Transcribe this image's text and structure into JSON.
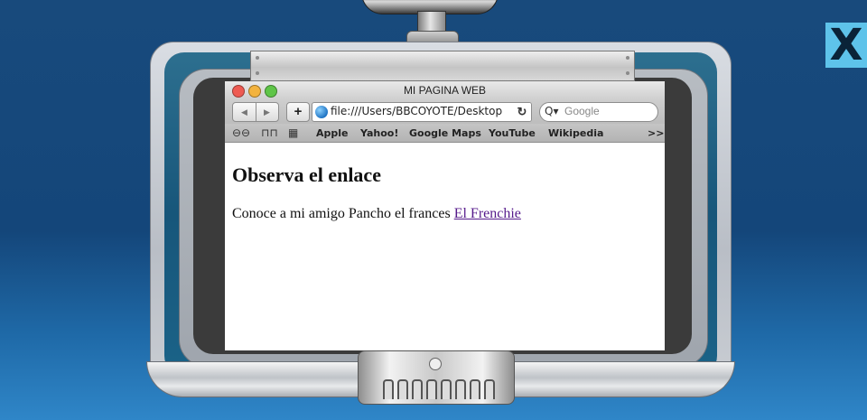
{
  "close_button": {
    "label": "X"
  },
  "browser": {
    "title": "MI PAGINA WEB",
    "url": "file:///Users/BBCOYOTE/Desktop",
    "search_placeholder": "Google",
    "bookmarks": [
      "Apple",
      "Yahoo!",
      "Google Maps",
      "YouTube",
      "Wikipedia"
    ],
    "bookmark_overflow": ">>"
  },
  "page": {
    "heading": "Observa el enlace",
    "text": "Conoce a mi amigo Pancho el frances ",
    "link_text": "El Frenchie"
  },
  "colors": {
    "background": "#184a7c",
    "close_button": "#5ec3ea",
    "link_visited": "#551a8b",
    "traffic_red": "#ee5b52",
    "traffic_yellow": "#f3b33e",
    "traffic_green": "#5fc548"
  },
  "icons": [
    "back-icon",
    "forward-icon",
    "add-bookmark-icon",
    "globe-icon",
    "reload-icon",
    "search-icon",
    "reading-glasses-icon",
    "book-icon",
    "grid-icon"
  ]
}
